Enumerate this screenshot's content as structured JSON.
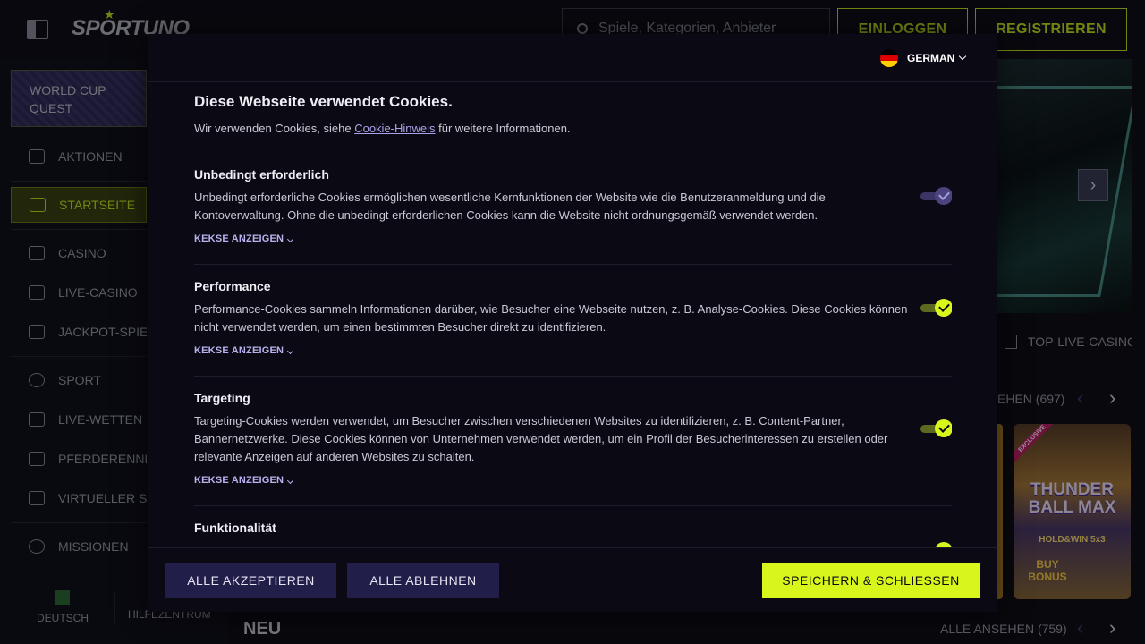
{
  "header": {
    "logo_text": "SPORTUNO",
    "search_placeholder": "Spiele, Kategorien, Anbieter",
    "login_label": "EINLOGGEN",
    "register_label": "REGISTRIEREN"
  },
  "sidebar": {
    "quest_label": "WORLD CUP QUEST",
    "items": [
      {
        "label": "AKTIONEN",
        "icon": "gift-icon"
      },
      {
        "label": "STARTSEITE",
        "icon": "home-icon",
        "active": true
      },
      {
        "label": "CASINO",
        "icon": "slot-machine-icon"
      },
      {
        "label": "LIVE-CASINO",
        "icon": "playing-card-icon"
      },
      {
        "label": "JACKPOT-SPIELE",
        "icon": "jackpot-icon"
      },
      {
        "label": "SPORT",
        "icon": "soccer-ball-icon"
      },
      {
        "label": "LIVE-WETTEN",
        "icon": "video-camera-icon"
      },
      {
        "label": "PFERDERENNEN",
        "icon": "horse-icon"
      },
      {
        "label": "VIRTUELLER SPORT",
        "icon": "gamepad-icon"
      },
      {
        "label": "MISSIONEN",
        "icon": "medal-icon"
      }
    ],
    "footer_language": "DEUTSCH",
    "footer_help": "HILFEZENTRUM"
  },
  "main": {
    "live_casino_tab": "TOP-LIVE-CASINO",
    "row_view_count": "EHEN (697)",
    "tile": {
      "badge": "EXCLUSIVE",
      "title": "THUNDER BALL MAX",
      "subtitle": "HOLD&WIN 5x3",
      "bonus": "BUY BONUS"
    },
    "new_section_title": "NEU",
    "new_view_all": "ALLE ANSEHEN (759)"
  },
  "cookie_modal": {
    "language": "GERMAN",
    "title": "Diese Webseite verwendet Cookies.",
    "intro_before": "Wir verwenden Cookies, siehe ",
    "intro_link": "Cookie-Hinweis",
    "intro_after": " für weitere Informationen.",
    "show_cookies_label": "KEKSE ANZEIGEN",
    "sections": [
      {
        "title": "Unbedingt erforderlich",
        "description": "Unbedingt erforderliche Cookies ermöglichen wesentliche Kernfunktionen der Website wie die Benutzeranmeldung und die Kontoverwaltung. Ohne die unbedingt erforderlichen Cookies kann die Website nicht ordnungsgemäß verwendet werden.",
        "enabled": true,
        "locked": true
      },
      {
        "title": "Performance",
        "description": "Performance-Cookies sammeln Informationen darüber, wie Besucher eine Webseite nutzen, z. B. Analyse-Cookies. Diese Cookies können nicht verwendet werden, um einen bestimmten Besucher direkt zu identifizieren.",
        "enabled": true,
        "locked": false
      },
      {
        "title": "Targeting",
        "description": "Targeting-Cookies werden verwendet, um Besucher zwischen verschiedenen Websites zu identifizieren, z. B. Content-Partner, Bannernetzwerke. Diese Cookies können von Unternehmen verwendet werden, um ein Profil der Besucherinteressen zu erstellen oder relevante Anzeigen auf anderen Websites zu schalten.",
        "enabled": true,
        "locked": false
      },
      {
        "title": "Funktionalität",
        "description": "",
        "enabled": true,
        "locked": false
      }
    ],
    "accept_all_label": "ALLE AKZEPTIEREN",
    "reject_all_label": "ALLE ABLEHNEN",
    "save_close_label": "SPEICHERN & SCHLIESSEN"
  },
  "colors": {
    "accent": "#d8f51c",
    "background": "#0e0e18",
    "modal_background": "#0b0a14",
    "secondary_button": "#221e4a"
  }
}
